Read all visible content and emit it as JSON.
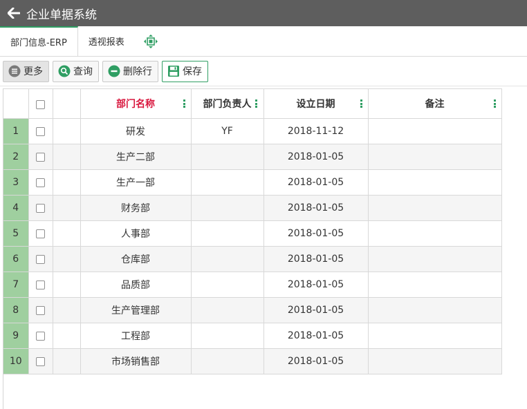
{
  "app": {
    "title": "企业单据系统"
  },
  "tabs": [
    {
      "label": "部门信息-ERP"
    },
    {
      "label": "透视报表"
    }
  ],
  "toolbar": {
    "more_label": "更多",
    "query_label": "查询",
    "delete_row_label": "删除行",
    "save_label": "保存"
  },
  "colors": {
    "accent": "#2f9e63",
    "header_red": "#d9183f",
    "row_number_bg": "#9fcf9f",
    "titlebar_bg": "#5e5e5e"
  },
  "grid": {
    "columns": [
      "部门名称",
      "部门负责人",
      "设立日期",
      "备注"
    ],
    "rows": [
      {
        "num": "1",
        "name": "研发",
        "manager": "YF",
        "date": "2018-11-12",
        "note": ""
      },
      {
        "num": "2",
        "name": "生产二部",
        "manager": "",
        "date": "2018-01-05",
        "note": ""
      },
      {
        "num": "3",
        "name": "生产一部",
        "manager": "",
        "date": "2018-01-05",
        "note": ""
      },
      {
        "num": "4",
        "name": "财务部",
        "manager": "",
        "date": "2018-01-05",
        "note": ""
      },
      {
        "num": "5",
        "name": "人事部",
        "manager": "",
        "date": "2018-01-05",
        "note": ""
      },
      {
        "num": "6",
        "name": "仓库部",
        "manager": "",
        "date": "2018-01-05",
        "note": ""
      },
      {
        "num": "7",
        "name": "品质部",
        "manager": "",
        "date": "2018-01-05",
        "note": ""
      },
      {
        "num": "8",
        "name": "生产管理部",
        "manager": "",
        "date": "2018-01-05",
        "note": ""
      },
      {
        "num": "9",
        "name": "工程部",
        "manager": "",
        "date": "2018-01-05",
        "note": ""
      },
      {
        "num": "10",
        "name": "市场销售部",
        "manager": "",
        "date": "2018-01-05",
        "note": ""
      }
    ]
  }
}
